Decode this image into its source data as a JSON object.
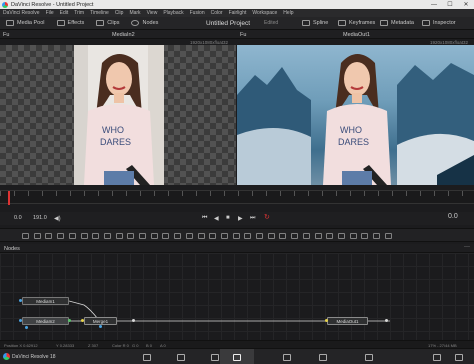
{
  "window": {
    "title": "DaVinci Resolve - Untitled Project",
    "min": "—",
    "max": "☐",
    "close": "✕"
  },
  "menu": [
    "DaVinci Resolve",
    "File",
    "Edit",
    "Trim",
    "Timeline",
    "Clip",
    "Mark",
    "View",
    "Playback",
    "Fusion",
    "Color",
    "Fairlight",
    "Workspace",
    "Help"
  ],
  "toolbar": {
    "media_pool": "Media Pool",
    "effects": "Effects",
    "clips": "Clips",
    "nodes": "Nodes",
    "project": "Untitled Project",
    "edited": "Edited",
    "spline": "Spline",
    "keyframes": "Keyframes",
    "metadata": "Metadata",
    "inspector": "Inspector"
  },
  "viewer": {
    "left_name": "MediaIn2",
    "right_name": "MediaOut1",
    "left_res": "1920x1080xfloat32",
    "right_res": "1920x1080xfloat32",
    "left_marker": "Fu",
    "right_marker": "Fu"
  },
  "transport": {
    "start": "0.0",
    "end": "191.0",
    "current": "0.0"
  },
  "nodes_panel": {
    "title": "Nodes",
    "nodes": {
      "media_in1": "MediaIn1",
      "media_in2": "MediaIn2",
      "merge": "Merge1",
      "media_out": "MediaOut1"
    }
  },
  "status": {
    "position": "Position X 0.62912",
    "y": "Y 0.28333",
    "z": "Z 307",
    "color": "Color R 0",
    "g": "G 0",
    "b": "B 0",
    "a": "A 0",
    "zoom": "17% - 27/44 MB"
  },
  "app": {
    "name": "DaVinci Resolve 18"
  },
  "colors": {
    "accent_red": "#d33333",
    "accent_blue": "#4aa3e0",
    "accent_green": "#58c26a",
    "accent_yellow": "#e6d24a"
  }
}
